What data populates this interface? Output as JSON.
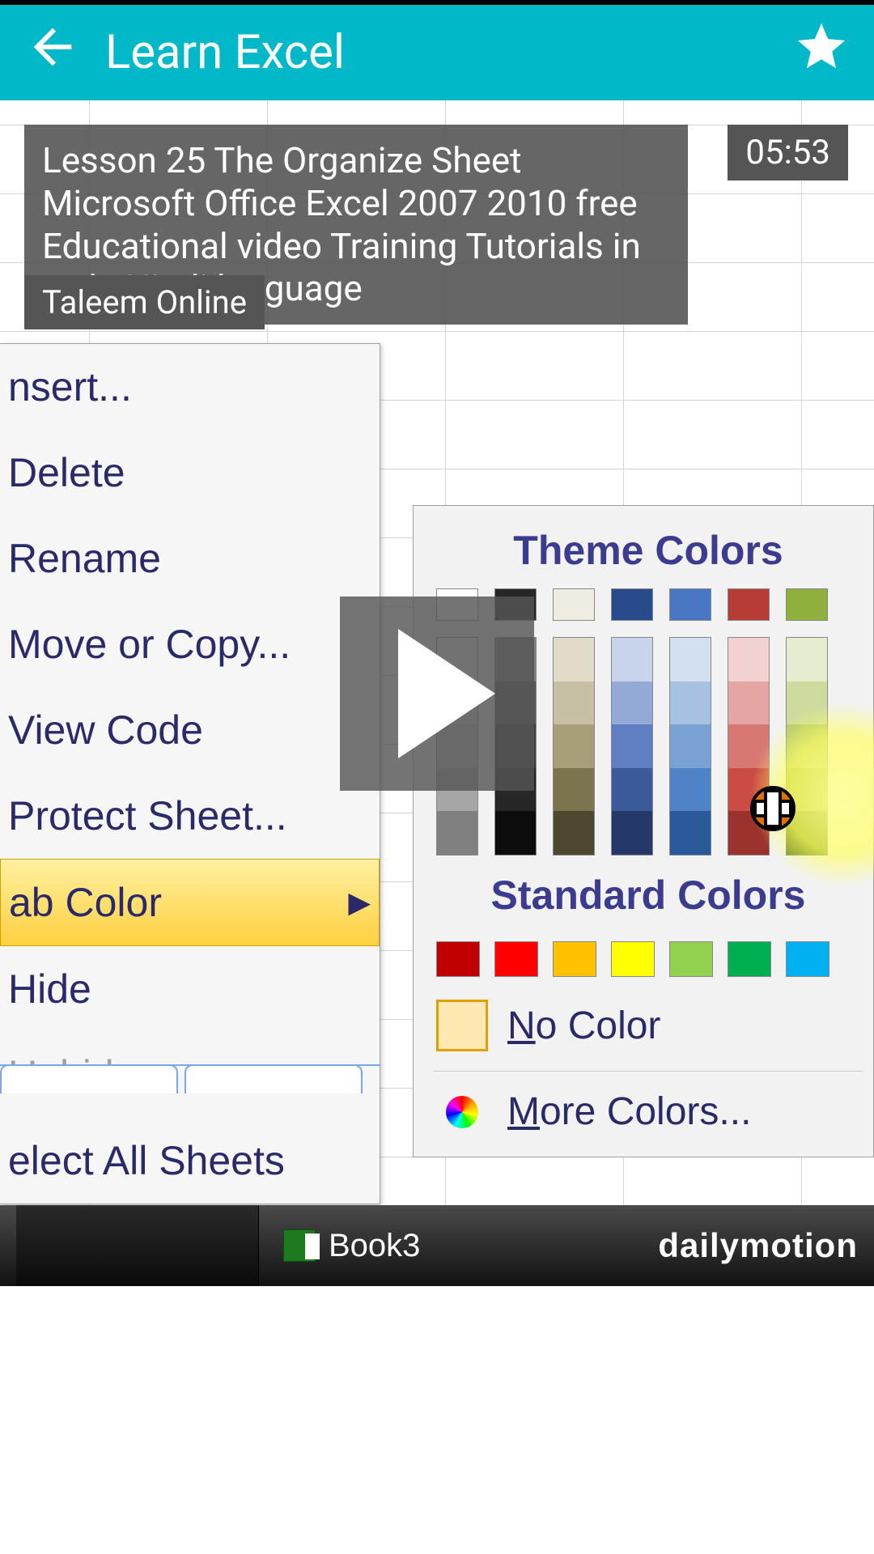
{
  "titlebar": {
    "title": "Learn Excel"
  },
  "video": {
    "title": "Lesson 25 The Organize Sheet Microsoft Office Excel 2007 2010 free Educational video Training Tutorials in Urdu Hindi language",
    "duration": "05:53",
    "channel": "Taleem Online",
    "taskbar_doc": "Book3",
    "brand": "dailymotion"
  },
  "context_menu": {
    "items": [
      {
        "label": "nsert...",
        "state": "enabled"
      },
      {
        "label": "Delete",
        "state": "enabled"
      },
      {
        "label": "Rename",
        "state": "enabled"
      },
      {
        "label": "Move or Copy...",
        "state": "enabled"
      },
      {
        "label": "View Code",
        "state": "enabled"
      },
      {
        "label": "Protect Sheet...",
        "state": "enabled"
      },
      {
        "label": "ab Color",
        "state": "highlight"
      },
      {
        "label": "Hide",
        "state": "enabled"
      },
      {
        "label": "Unhide...",
        "state": "disabled"
      },
      {
        "label": "elect All Sheets",
        "state": "enabled"
      }
    ]
  },
  "color_panel": {
    "theme_heading": "Theme Colors",
    "theme_colors": [
      "#ffffff",
      "#262626",
      "#efece1",
      "#284b8b",
      "#4a77c4",
      "#b73c36",
      "#8fb03c"
    ],
    "shade_columns": [
      [
        "#f2f2f2",
        "#d9d9d9",
        "#bfbfbf",
        "#a6a6a6",
        "#808080"
      ],
      [
        "#7f7f7f",
        "#595959",
        "#404040",
        "#262626",
        "#0d0d0d"
      ],
      [
        "#e1dcc9",
        "#c7bfa3",
        "#a89e78",
        "#7c744f",
        "#4e4830"
      ],
      [
        "#c7d4ea",
        "#93a9d6",
        "#5f7fc2",
        "#3a5a99",
        "#24386a"
      ],
      [
        "#d3e0f1",
        "#a7c1e3",
        "#7ba2d5",
        "#4f83c7",
        "#2a5a99"
      ],
      [
        "#f2d2d0",
        "#e5a5a2",
        "#d87873",
        "#cb4b45",
        "#9b322d"
      ],
      [
        "#e6edcf",
        "#cddb9f",
        "#b4c96f",
        "#9bb73f",
        "#6f8a22"
      ]
    ],
    "standard_heading": "Standard Colors",
    "standard_colors": [
      "#c00000",
      "#ff0000",
      "#ffc000",
      "#ffff00",
      "#92d050",
      "#00b050",
      "#00b0f0"
    ],
    "no_color_label": "No Color",
    "more_colors_label": "More Colors..."
  }
}
